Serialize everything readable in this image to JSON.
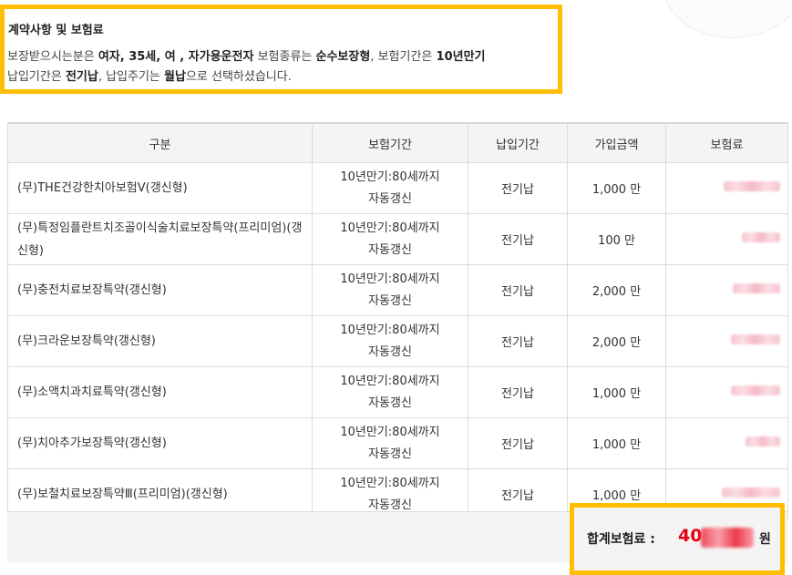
{
  "summary": {
    "title": "계약사항 및 보험료",
    "line1": [
      {
        "t": "보장받으시는분은 ",
        "b": false
      },
      {
        "t": "여자, 35세, 여 , 자가용운전자",
        "b": true
      },
      {
        "t": " 보험종류는 ",
        "b": false
      },
      {
        "t": "순수보장형",
        "b": true
      },
      {
        "t": ", 보험기간은 ",
        "b": false
      },
      {
        "t": "10년만기",
        "b": true
      }
    ],
    "line2": [
      {
        "t": "납입기간은 ",
        "b": false
      },
      {
        "t": "전기납",
        "b": true
      },
      {
        "t": ", 납입주기는 ",
        "b": false
      },
      {
        "t": "월납",
        "b": true
      },
      {
        "t": "으로 선택하셨습니다.",
        "b": false
      }
    ]
  },
  "table": {
    "headers": [
      "구분",
      "보험기간",
      "납입기간",
      "가입금액",
      "보험료"
    ],
    "rows": [
      {
        "name": "(무)THE건강한치아보험V(갱신형)",
        "period1": "10년만기:80세까지",
        "period2": "자동갱신",
        "pay": "전기납",
        "amount": "1,000 만"
      },
      {
        "name": "(무)특정임플란트치조골이식술치료보장특약(프리미엄)(갱신형)",
        "period1": "10년만기:80세까지",
        "period2": "자동갱신",
        "pay": "전기납",
        "amount": "100 만"
      },
      {
        "name": "(무)충전치료보장특약(갱신형)",
        "period1": "10년만기:80세까지",
        "period2": "자동갱신",
        "pay": "전기납",
        "amount": "2,000 만"
      },
      {
        "name": "(무)크라운보장특약(갱신형)",
        "period1": "10년만기:80세까지",
        "period2": "자동갱신",
        "pay": "전기납",
        "amount": "2,000 만"
      },
      {
        "name": "(무)소액치과치료특약(갱신형)",
        "period1": "10년만기:80세까지",
        "period2": "자동갱신",
        "pay": "전기납",
        "amount": "1,000 만"
      },
      {
        "name": "(무)치아추가보장특약(갱신형)",
        "period1": "10년만기:80세까지",
        "period2": "자동갱신",
        "pay": "전기납",
        "amount": "1,000 만"
      },
      {
        "name": "(무)보철치료보장특약Ⅲ(프리미엄)(갱신형)",
        "period1": "10년만기:80세까지",
        "period2": "자동갱신",
        "pay": "전기납",
        "amount": "1,000 만"
      }
    ]
  },
  "total": {
    "label": "합계보험료 :",
    "value_visible": "40",
    "unit": "원"
  },
  "colors": {
    "highlight": "#ffbf00",
    "total_value": "#e60012",
    "header_bg": "#f4f4f4"
  }
}
